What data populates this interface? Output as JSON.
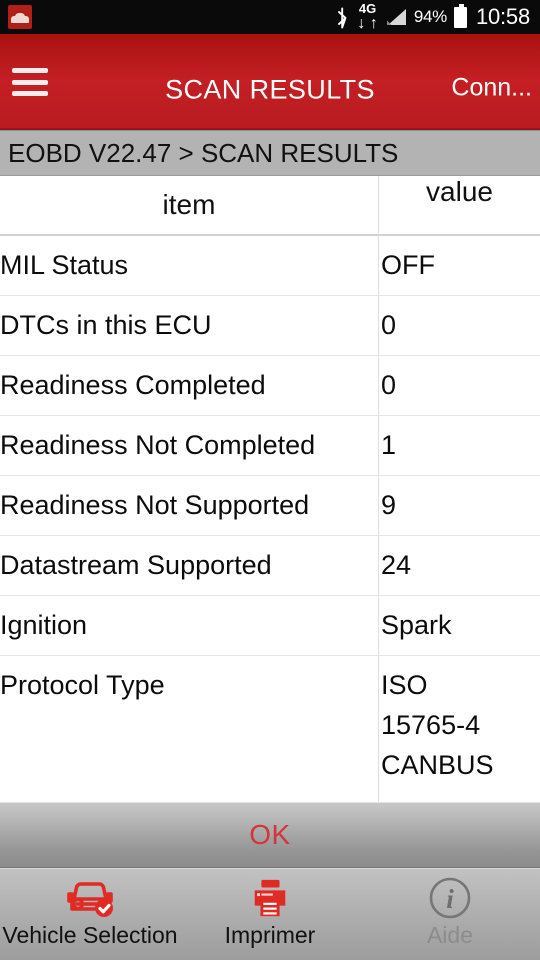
{
  "statusbar": {
    "notification_icon": "car-app-icon",
    "bluetooth_icon": "bluetooth-icon",
    "network_label": "4G",
    "network_down": "↓",
    "network_up": "↑",
    "signal_icon": "signal-bars-icon",
    "battery_percent": "94%",
    "battery_icon": "battery-icon",
    "clock": "10:58"
  },
  "appbar": {
    "menu_icon": "hamburger-menu-icon",
    "title": "SCAN RESULTS",
    "action_label": "Conn..."
  },
  "breadcrumb": {
    "text": "EOBD V22.47 > SCAN RESULTS"
  },
  "table": {
    "columns": {
      "item": "item",
      "value": "value"
    },
    "rows": [
      {
        "item": "MIL Status",
        "value": "OFF"
      },
      {
        "item": "DTCs in this ECU",
        "value": "0"
      },
      {
        "item": "Readiness Completed",
        "value": "0"
      },
      {
        "item": "Readiness Not Completed",
        "value": "1"
      },
      {
        "item": "Readiness Not Supported",
        "value": "9"
      },
      {
        "item": "Datastream Supported",
        "value": "24"
      },
      {
        "item": "Ignition",
        "value": "Spark"
      },
      {
        "item": "Protocol Type",
        "value": "ISO\n15765-4\nCANBUS"
      }
    ]
  },
  "ok_button": {
    "label": "OK"
  },
  "bottomnav": {
    "items": [
      {
        "label": "Vehicle Selection",
        "icon": "car-check-icon",
        "enabled": true
      },
      {
        "label": "Imprimer",
        "icon": "printer-icon",
        "enabled": true
      },
      {
        "label": "Aide",
        "icon": "info-circle-icon",
        "enabled": false
      }
    ]
  },
  "colors": {
    "brand_red": "#c41f24",
    "accent_red": "#d2353a",
    "breadcrumb_bg": "#b3b3b3",
    "nav_bg": "#b0b0b0",
    "disabled_gray": "#8c8c8c"
  }
}
